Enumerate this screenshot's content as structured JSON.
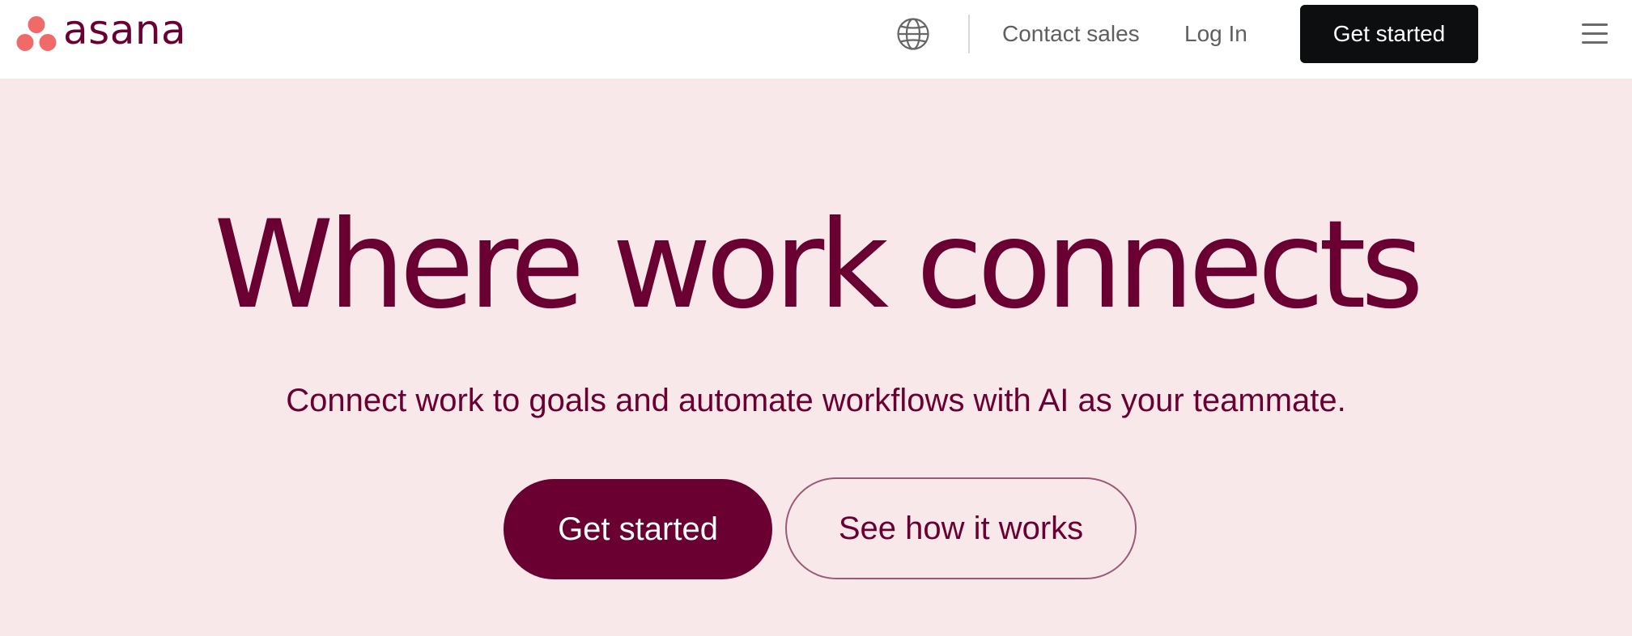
{
  "brand": {
    "name": "asana",
    "primary_color": "#690031",
    "logo_dot_color": "#f06a6a"
  },
  "header": {
    "language_icon": "globe-icon",
    "contact_sales_label": "Contact sales",
    "login_label": "Log In",
    "cta_label": "Get started",
    "menu_icon": "hamburger-menu-icon"
  },
  "hero": {
    "title": "Where work connects",
    "subtitle": "Connect work to goals and automate workflows with AI as your teammate.",
    "primary_cta_label": "Get started",
    "secondary_cta_label": "See how it works"
  }
}
